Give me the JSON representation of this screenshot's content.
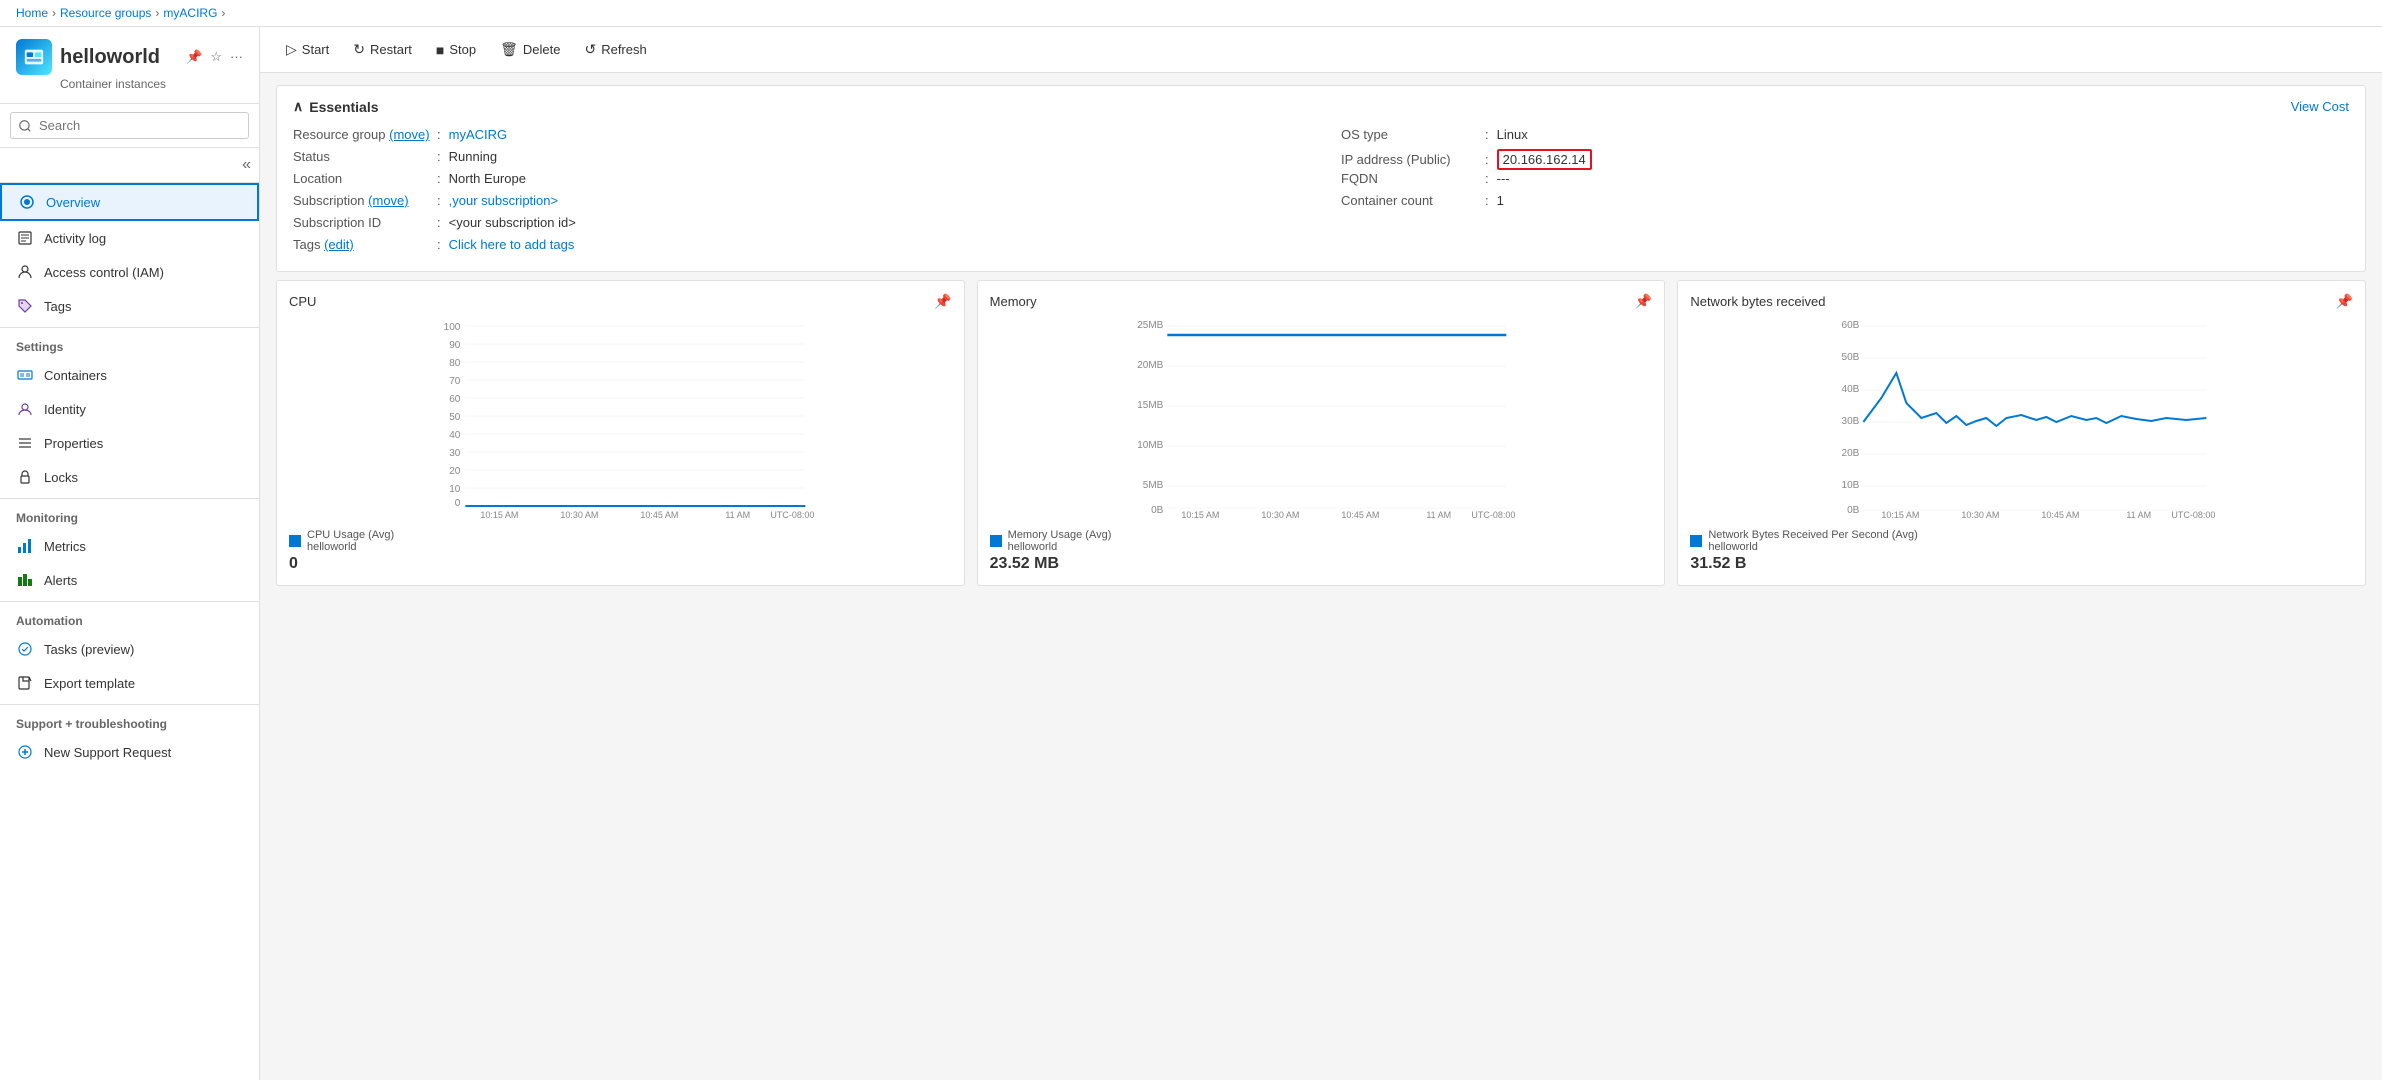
{
  "breadcrumb": {
    "items": [
      "Home",
      "Resource groups",
      "myACIRG"
    ]
  },
  "app": {
    "title": "helloworld",
    "subtitle": "Container instances"
  },
  "sidebar": {
    "search_placeholder": "Search",
    "nav_items": [
      {
        "id": "overview",
        "label": "Overview",
        "active": true
      },
      {
        "id": "activity-log",
        "label": "Activity log",
        "active": false
      },
      {
        "id": "access-control",
        "label": "Access control (IAM)",
        "active": false
      },
      {
        "id": "tags",
        "label": "Tags",
        "active": false
      }
    ],
    "settings_section": "Settings",
    "settings_items": [
      {
        "id": "containers",
        "label": "Containers"
      },
      {
        "id": "identity",
        "label": "Identity"
      },
      {
        "id": "properties",
        "label": "Properties"
      },
      {
        "id": "locks",
        "label": "Locks"
      }
    ],
    "monitoring_section": "Monitoring",
    "monitoring_items": [
      {
        "id": "metrics",
        "label": "Metrics"
      },
      {
        "id": "alerts",
        "label": "Alerts"
      }
    ],
    "automation_section": "Automation",
    "automation_items": [
      {
        "id": "tasks",
        "label": "Tasks (preview)"
      },
      {
        "id": "export-template",
        "label": "Export template"
      }
    ],
    "support_section": "Support + troubleshooting",
    "support_items": [
      {
        "id": "new-support",
        "label": "New Support Request"
      }
    ]
  },
  "toolbar": {
    "start_label": "Start",
    "restart_label": "Restart",
    "stop_label": "Stop",
    "delete_label": "Delete",
    "refresh_label": "Refresh"
  },
  "essentials": {
    "title": "Essentials",
    "view_cost_label": "View Cost",
    "fields_left": [
      {
        "label": "Resource group (move)",
        "value": "myACIRG",
        "is_link": true
      },
      {
        "label": "Status",
        "value": "Running"
      },
      {
        "label": "Location",
        "value": "North Europe"
      },
      {
        "label": "Subscription (move)",
        "value": ",your subscription>",
        "is_link": true
      },
      {
        "label": "Subscription ID",
        "value": "<your subscription id>"
      },
      {
        "label": "Tags (edit)",
        "value": "Click here to add tags",
        "is_link": true
      }
    ],
    "fields_right": [
      {
        "label": "OS type",
        "value": "Linux"
      },
      {
        "label": "IP address (Public)",
        "value": "20.166.162.14",
        "highlight": true
      },
      {
        "label": "FQDN",
        "value": "---"
      },
      {
        "label": "Container count",
        "value": "1"
      }
    ]
  },
  "charts": {
    "cpu": {
      "title": "CPU",
      "y_labels": [
        "100",
        "90",
        "80",
        "70",
        "60",
        "50",
        "40",
        "30",
        "20",
        "10",
        "0"
      ],
      "x_labels": [
        "10:15 AM",
        "10:30 AM",
        "10:45 AM",
        "11 AM",
        "UTC-08:00"
      ],
      "legend_text": "CPU Usage (Avg)",
      "legend_sub": "helloworld",
      "value": "0"
    },
    "memory": {
      "title": "Memory",
      "y_labels": [
        "25MB",
        "20MB",
        "15MB",
        "10MB",
        "5MB",
        "0B"
      ],
      "x_labels": [
        "10:15 AM",
        "10:30 AM",
        "10:45 AM",
        "11 AM",
        "UTC-08:00"
      ],
      "legend_text": "Memory Usage (Avg)",
      "legend_sub": "helloworld",
      "value": "23.52 MB"
    },
    "network": {
      "title": "Network bytes received",
      "y_labels": [
        "60B",
        "50B",
        "40B",
        "30B",
        "20B",
        "10B",
        "0B"
      ],
      "x_labels": [
        "10:15 AM",
        "10:30 AM",
        "10:45 AM",
        "11 AM",
        "UTC-08:00"
      ],
      "legend_text": "Network Bytes Received Per Second (Avg)",
      "legend_sub": "helloworld",
      "value": "31.52 B"
    }
  }
}
